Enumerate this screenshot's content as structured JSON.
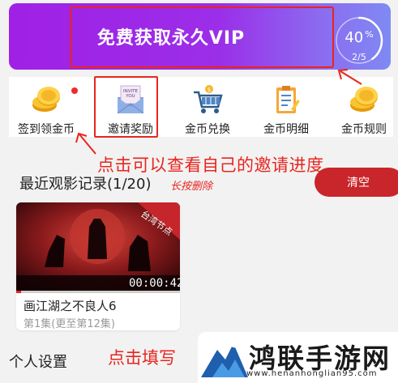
{
  "vip": {
    "title": "免费获取永久VIP",
    "progress_percent": "40",
    "percent_sign": "%",
    "progress_fraction": "2/5",
    "progress_value": 0.4
  },
  "coin_menu": [
    {
      "label": "签到领金币",
      "icon": "coin-icon"
    },
    {
      "label": "邀请奖励",
      "icon": "invite-envelope-icon"
    },
    {
      "label": "金币兑换",
      "icon": "shopping-cart-icon"
    },
    {
      "label": "金币明细",
      "icon": "clipboard-icon"
    },
    {
      "label": "金币规则",
      "icon": "coin-icon"
    }
  ],
  "annotations": {
    "invite_note": "点击可以查看自己的邀请进度",
    "fill_note": "点击填写"
  },
  "recent": {
    "title": "最近观影记录(1/20)",
    "hint": "长按删除",
    "clear_label": "清空",
    "items": [
      {
        "title": "画江湖之不良人6",
        "subtitle": "第1集(更至第12集)",
        "duration": "00:00:42",
        "region_tag": "台湾节点"
      }
    ]
  },
  "settings": {
    "label": "个人设置"
  },
  "watermark": {
    "text": "鸿联手游网",
    "url": "www.henanhonglian95.com"
  },
  "colors": {
    "accent_red": "#e8251f",
    "banner_purple": "#a020e6",
    "clear_button": "#c8262a"
  }
}
